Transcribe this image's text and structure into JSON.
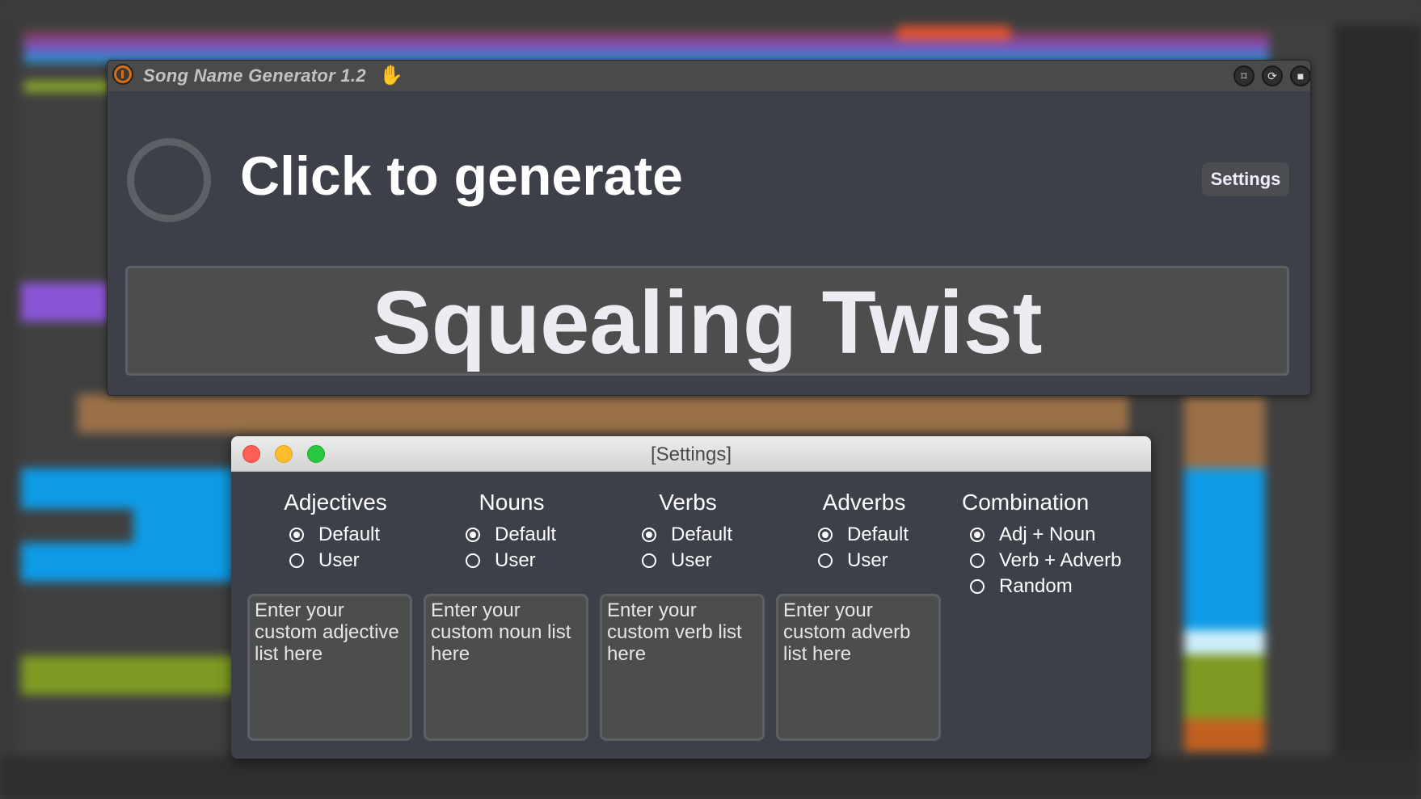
{
  "plugin": {
    "title": "Song Name Generator 1.2",
    "generate_label": "Click to generate",
    "settings_label": "Settings",
    "result": "Squealing Twist",
    "icons": [
      "power-icon",
      "hand-icon",
      "freeze-icon",
      "sync-icon",
      "save-icon"
    ]
  },
  "settings": {
    "title": "[Settings]",
    "columns": [
      {
        "heading": "Adjectives",
        "options": [
          {
            "label": "Default",
            "selected": true
          },
          {
            "label": "User",
            "selected": false
          }
        ],
        "placeholder": "Enter your custom adjective list here"
      },
      {
        "heading": "Nouns",
        "options": [
          {
            "label": "Default",
            "selected": true
          },
          {
            "label": "User",
            "selected": false
          }
        ],
        "placeholder": "Enter your custom noun list here"
      },
      {
        "heading": "Verbs",
        "options": [
          {
            "label": "Default",
            "selected": true
          },
          {
            "label": "User",
            "selected": false
          }
        ],
        "placeholder": "Enter your custom verb list here"
      },
      {
        "heading": "Adverbs",
        "options": [
          {
            "label": "Default",
            "selected": true
          },
          {
            "label": "User",
            "selected": false
          }
        ],
        "placeholder": "Enter your custom adverb list here"
      }
    ],
    "combination": {
      "heading": "Combination",
      "options": [
        {
          "label": "Adj + Noun",
          "selected": true
        },
        {
          "label": "Verb + Adverb",
          "selected": false
        },
        {
          "label": "Random",
          "selected": false
        }
      ]
    }
  },
  "colors": {
    "accent_power": "#d86f14",
    "panel_bg": "#3d4048",
    "field_bg": "#4b4e4d"
  }
}
